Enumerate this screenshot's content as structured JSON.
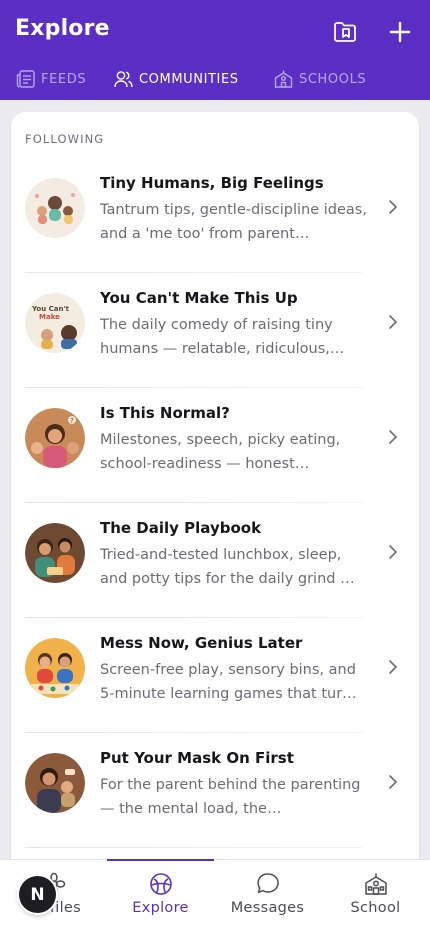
{
  "header": {
    "title": "Explore",
    "bookmark_icon": "folder-bookmark-icon",
    "add_icon": "plus-icon"
  },
  "tabs": [
    {
      "label": "FEEDS",
      "icon": "feeds-icon",
      "active": false
    },
    {
      "label": "COMMUNITIES",
      "icon": "people-icon",
      "active": true
    },
    {
      "label": "SCHOOLS",
      "icon": "school-icon",
      "active": false
    }
  ],
  "section": {
    "label": "FOLLOWING"
  },
  "communities": [
    {
      "title": "Tiny Humans, Big Feelings",
      "description": "Tantrum tips, gentle-discipline ideas, and a 'me too' from parent…"
    },
    {
      "title": "You Can't Make This Up",
      "description": "The daily comedy of raising tiny humans — relatable, ridiculous,…"
    },
    {
      "title": "Is This Normal?",
      "description": "Milestones, speech, picky eating, school-readiness — honest…"
    },
    {
      "title": "The Daily Playbook",
      "description": "Tried-and-tested lunchbox, sleep, and potty tips for the daily grind …"
    },
    {
      "title": "Mess Now, Genius Later",
      "description": "Screen-free play, sensory bins, and 5-minute learning games that tur…"
    },
    {
      "title": "Put Your Mask On First",
      "description": "For the parent behind the parenting — the mental load, the…"
    }
  ],
  "nav": [
    {
      "label": "Profiles",
      "icon": "flower-icon",
      "active": false
    },
    {
      "label": "Explore",
      "icon": "compass-icon",
      "active": true
    },
    {
      "label": "Messages",
      "icon": "chat-bubble-icon",
      "active": false
    },
    {
      "label": "School",
      "icon": "school-building-icon",
      "active": false
    }
  ],
  "user": {
    "initial": "N"
  },
  "colors": {
    "brand": "#5b2fc4",
    "tab_inactive": "#b7a5ec",
    "background": "#eceaf1"
  }
}
